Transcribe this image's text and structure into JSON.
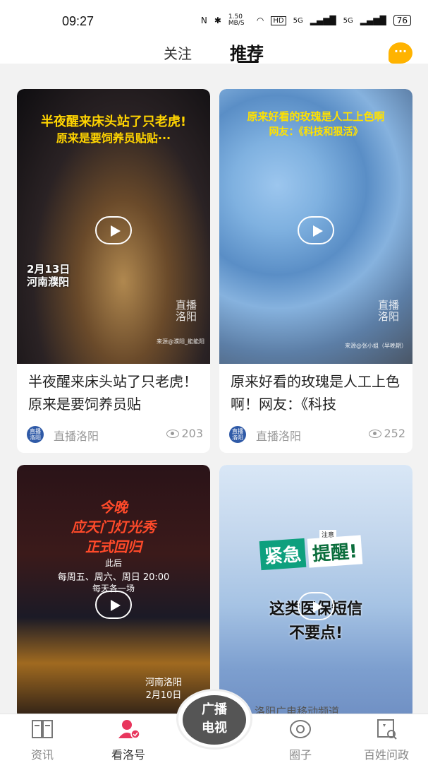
{
  "status_bar": {
    "time": "09:27",
    "network_speed": "1.50 MB/S",
    "signal_1": "5G",
    "signal_2": "5G",
    "battery": "76"
  },
  "top_tabs": [
    {
      "label": "关注",
      "active": false
    },
    {
      "label": "推荐",
      "active": true
    }
  ],
  "chat_icon": "chat-bubble-icon",
  "cards": [
    {
      "overlay_line1": "半夜醒来床头站了只老虎!",
      "overlay_line2": "原来是要饲养员贴贴···",
      "overlay_date": "2月13日",
      "overlay_place": "河南濮阳",
      "watermark": "直播洛阳",
      "source_note": "来源@濮阳_能能阳",
      "title": "半夜醒来床头站了只老虎！原来是要饲养员贴",
      "channel": "直播洛阳",
      "views": "203"
    },
    {
      "overlay_line1": "原来好看的玫瑰是人工上色啊",
      "overlay_line2": "网友：《科技和狠活》",
      "watermark": "直播洛阳",
      "source_note": "来源@张小姐（早晚期）",
      "title": "原来好看的玫瑰是人工上色啊！网友：《科技",
      "channel": "直播洛阳",
      "views": "252"
    },
    {
      "overlay_line1": "今晚",
      "overlay_line2": "应天门灯光秀",
      "overlay_line3": "正式回归",
      "overlay_line4": "此后",
      "overlay_line5": "每周五、周六、周日 20:00",
      "overlay_line6": "每天各一场",
      "overlay_place": "河南洛阳",
      "overlay_date": "2月10日"
    },
    {
      "overlay_note": "注意",
      "overlay_badge1": "紧急",
      "overlay_badge2": "提醒!",
      "overlay_line1": "这类医保短信",
      "overlay_line2": "不要点!",
      "overlay_bottom": "洛阳广电移动频道"
    }
  ],
  "bottom_nav": [
    {
      "label": "资讯",
      "icon": "book-icon",
      "active": false
    },
    {
      "label": "看洛号",
      "icon": "user-check-icon",
      "active": true
    },
    {
      "label": "广播电视",
      "icon": "tv-icon",
      "active": false
    },
    {
      "label": "圈子",
      "icon": "circle-icon",
      "active": false
    },
    {
      "label": "百姓问政",
      "icon": "question-board-icon",
      "active": false
    }
  ],
  "center_button": {
    "line1": "广播",
    "line2": "电视"
  }
}
